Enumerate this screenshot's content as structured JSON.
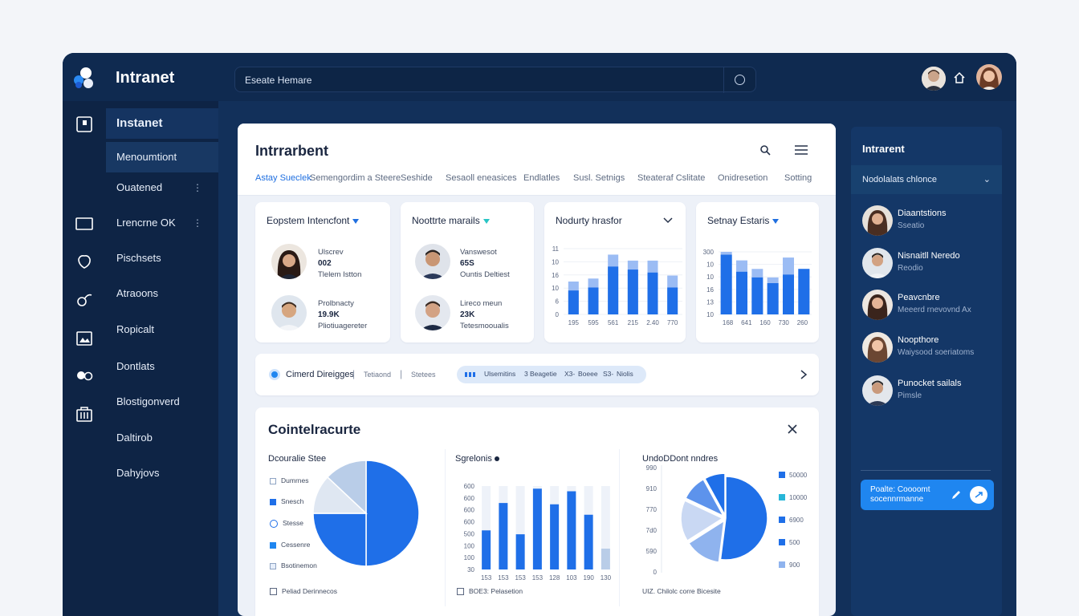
{
  "app": {
    "title": "Intranet"
  },
  "search": {
    "value": "Eseate Hemare"
  },
  "sidebar": {
    "items": [
      {
        "label": "Instanet"
      },
      {
        "label": "Menoumtiont"
      },
      {
        "label": "Ouatened"
      },
      {
        "label": "Lrencrne OK"
      },
      {
        "label": "Pischsets"
      },
      {
        "label": "Atraoons"
      },
      {
        "label": "Ropicalt"
      },
      {
        "label": "Dontlats"
      },
      {
        "label": "Blostigonverd"
      },
      {
        "label": "Daltirob"
      },
      {
        "label": "Dahyjovs"
      }
    ]
  },
  "main": {
    "title": "Intrrarbent",
    "tabs": [
      "Astay Sueclek",
      "Semengordim a Steere",
      "Seshide",
      "Sesaoll eneasices",
      "Endlatles",
      "Susl. Setnigs",
      "Steateraf Cslitate",
      "Onidresetion",
      "Sotting"
    ]
  },
  "cards": {
    "card1": {
      "title": "Eopstem Intencfont",
      "p1": {
        "l1": "Ulscrev",
        "l2": "002",
        "l3": "Tlelem Istton"
      },
      "p2": {
        "l1": "Prolbnacty",
        "l2": "19.9K",
        "l3": "Pliotiuagereter"
      }
    },
    "card2": {
      "title": "Noottrte marails",
      "p1": {
        "l1": "Vanswesot",
        "l2": "65S",
        "l3": "Ountis Deltiest"
      },
      "p2": {
        "l1": "Lireco meun",
        "l2": "23K",
        "l3": "Tetesmooualis"
      }
    },
    "card3": {
      "title": "Nodurty hrasfor"
    },
    "card4": {
      "title": "Setnay Estaris"
    }
  },
  "banner": {
    "item1": "Cimerd Direigges",
    "item2": "Tetiaond",
    "item3": "Stetees",
    "pill": [
      "Ulsemitins",
      "Beagetie",
      "Boeee",
      "Niolis"
    ],
    "pill_prefix": [
      "3",
      "X3-",
      "S3-"
    ]
  },
  "section": {
    "title": "Cointelracurte",
    "pie1": {
      "title": "Dcouralie Stee",
      "legend": [
        "Dumrnes",
        "Snesch",
        "Stesse",
        "Cessenre",
        "Bsotinemon"
      ],
      "footer": "Peliad Derinnecos"
    },
    "bars": {
      "title": "Sgrelonis",
      "footer": "BOE3: Pelasetion"
    },
    "pie2": {
      "title": "UndoDDont nndres",
      "legend": [
        "50000",
        "10000",
        "6900",
        "500",
        "900"
      ],
      "footer": "UIZ. Chilolc corre Bicesite"
    }
  },
  "right_panel": {
    "title": "Intrarent",
    "select": "Nodolalats chlonce",
    "contacts": [
      {
        "name": "Diaantstions",
        "sub": "Sseatio"
      },
      {
        "name": "Nisnaitll Neredo",
        "sub": "Reodio"
      },
      {
        "name": "Peavcnbre",
        "sub": "Meeerd rnevovnd Ax"
      },
      {
        "name": "Noopthore",
        "sub": "Waiysood soeriatoms"
      },
      {
        "name": "Punocket sailals",
        "sub": "Pimsle"
      }
    ],
    "button": "Poalte: Coooomt socennrmanne"
  },
  "chart_data": [
    {
      "type": "bar",
      "title": "Nodurty hrasfor",
      "categories": [
        "195",
        "595",
        "561",
        "215",
        "2.40",
        "770"
      ],
      "series": [
        {
          "values": [
            5.5,
            6,
            10,
            9,
            9,
            6.5
          ]
        },
        {
          "values": [
            4,
            4.5,
            8,
            7.5,
            7,
            4.5
          ]
        }
      ],
      "yticks": [
        "11",
        "10",
        "16",
        "10",
        "6",
        "0"
      ],
      "colors": [
        "#9bbcf4",
        "#1f6fe8"
      ]
    },
    {
      "type": "bar",
      "title": "Setnay Estaris",
      "categories": [
        "168",
        "641",
        "160",
        "730",
        "260"
      ],
      "series": [
        {
          "values": [
            11,
            9.5,
            8,
            6.5,
            10,
            8
          ]
        },
        {
          "values": [
            10.5,
            7.5,
            6.5,
            5.5,
            7,
            8
          ]
        }
      ],
      "yticks": [
        "300",
        "10",
        "10",
        "16",
        "13",
        "10"
      ],
      "colors": [
        "#9bbcf4",
        "#1f6fe8"
      ]
    },
    {
      "type": "pie",
      "title": "Dcouralie Stee",
      "values": [
        50,
        25,
        12,
        13
      ],
      "colors": [
        "#1f6fe8",
        "#1f6fe8",
        "#dfe7f2",
        "#b9cde8"
      ]
    },
    {
      "type": "bar",
      "title": "Sgrelonis",
      "categories": [
        "153",
        "153",
        "153",
        "153",
        "128",
        "103",
        "190",
        "130"
      ],
      "series": [
        {
          "values": [
            300,
            510,
            270,
            620,
            500,
            600,
            420,
            160
          ]
        }
      ],
      "yticks": [
        "600",
        "600",
        "600",
        "600",
        "500",
        "100",
        "100",
        "30"
      ],
      "colors": [
        "#1f6fe8",
        "#b9cde8"
      ]
    },
    {
      "type": "pie",
      "title": "UndoDDont nndres",
      "values": [
        52,
        14,
        16,
        10,
        8
      ],
      "colors": [
        "#1f6fe8",
        "#8fb3ee",
        "#c9d8f3",
        "#5d93ec",
        "#1f6fe8"
      ],
      "yticks": [
        "990",
        "910",
        "770",
        "7d0",
        "590",
        "0"
      ]
    }
  ]
}
